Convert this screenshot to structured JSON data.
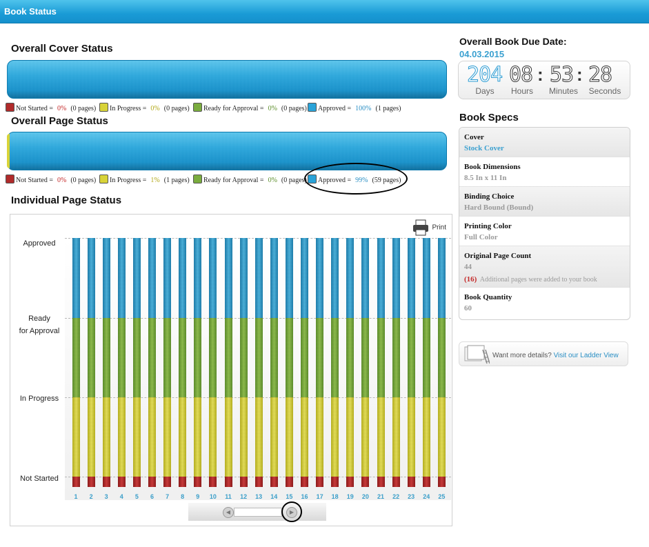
{
  "header": {
    "title": "Book Status"
  },
  "cover_status": {
    "title": "Overall Cover Status",
    "legend": [
      {
        "label": "Not Started =",
        "pct": "0%",
        "pages": "(0 pages)",
        "color": "#b02a2a"
      },
      {
        "label": "In Progress =",
        "pct": "0%",
        "pages": "(0 pages)",
        "color": "#d8d338"
      },
      {
        "label": "Ready for Approval =",
        "pct": "0%",
        "pages": "(0 pages)",
        "color": "#7aac3e"
      },
      {
        "label": "Approved =",
        "pct": "100%",
        "pages": "(1 pages)",
        "color": "#2aa3d8"
      }
    ]
  },
  "page_status": {
    "title": "Overall Page Status",
    "legend": [
      {
        "label": "Not Started =",
        "pct": "0%",
        "pages": "(0 pages)",
        "color": "#b02a2a"
      },
      {
        "label": "In Progress =",
        "pct": "1%",
        "pages": "(1 pages)",
        "color": "#d8d338"
      },
      {
        "label": "Ready for Approval =",
        "pct": "0%",
        "pages": "(0 pages)",
        "color": "#7aac3e"
      },
      {
        "label": "Approved =",
        "pct": "99%",
        "pages": "(59 pages)",
        "color": "#2aa3d8"
      }
    ]
  },
  "individual": {
    "title": "Individual Page Status",
    "print_label": "Print"
  },
  "chart_data": {
    "type": "bar",
    "categories": [
      "1",
      "2",
      "3",
      "4",
      "5",
      "6",
      "7",
      "8",
      "9",
      "10",
      "11",
      "12",
      "13",
      "14",
      "15",
      "16",
      "17",
      "18",
      "19",
      "20",
      "21",
      "22",
      "23",
      "24",
      "25"
    ],
    "y_levels": [
      "Not Started",
      "In Progress",
      "Ready for Approval",
      "Approved"
    ],
    "y_labels": [
      "Approved",
      "Ready\nfor Approval",
      "In Progress",
      "Not Started"
    ],
    "values": [
      3,
      3,
      3,
      3,
      3,
      3,
      3,
      3,
      3,
      3,
      3,
      3,
      3,
      3,
      3,
      3,
      3,
      3,
      3,
      3,
      3,
      3,
      3,
      3,
      3
    ],
    "segment_colors": [
      "#b02a2a",
      "#d8d338",
      "#7aac3e",
      "#2aa3d8"
    ]
  },
  "due_date": {
    "label": "Overall Book Due Date:",
    "value": "04.03.2015",
    "days": "204",
    "hours": "08",
    "minutes": "53",
    "seconds": "28",
    "days_label": "Days",
    "hours_label": "Hours",
    "minutes_label": "Minutes",
    "seconds_label": "Seconds"
  },
  "specs": {
    "title": "Book Specs",
    "rows": [
      {
        "label": "Cover",
        "value": "Stock Cover"
      },
      {
        "label": "Book Dimensions",
        "value": "8.5 In x 11 In"
      },
      {
        "label": "Binding Choice",
        "value": "Hard Bound (Bound)"
      },
      {
        "label": "Printing Color",
        "value": "Full Color"
      },
      {
        "label": "Original Page Count",
        "value": "44",
        "note_count": "(16)",
        "note_text": "Additional pages were added to your book"
      },
      {
        "label": "Book Quantity",
        "value": "60"
      }
    ]
  },
  "ladder": {
    "text": "Want more details?",
    "link": "Visit our Ladder View"
  }
}
